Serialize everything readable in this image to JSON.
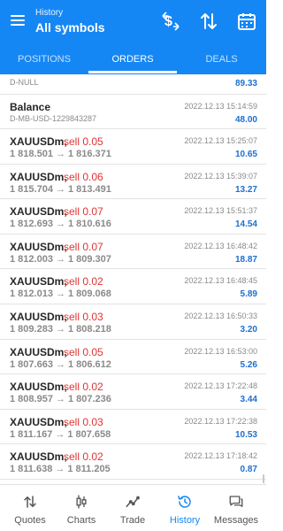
{
  "header": {
    "subtitle": "History",
    "title": "All symbols"
  },
  "tabs": [
    {
      "label": "POSITIONS"
    },
    {
      "label": "ORDERS",
      "active": true
    },
    {
      "label": "DEALS"
    }
  ],
  "top_partial": {
    "id": "D-NULL",
    "value": "89.33"
  },
  "balance": {
    "label": "Balance",
    "time": "2022.12.13 15:14:59",
    "id": "D-MB-USD-1229843287",
    "amount": "48.00"
  },
  "deals": [
    {
      "symbol": "XAUUSDm,",
      "side": "sell 0.05",
      "time": "2022.12.13 15:25:07",
      "open": "1 818.501",
      "close": "1 816.371",
      "profit": "10.65"
    },
    {
      "symbol": "XAUUSDm,",
      "side": "sell 0.06",
      "time": "2022.12.13 15:39:07",
      "open": "1 815.704",
      "close": "1 813.491",
      "profit": "13.27"
    },
    {
      "symbol": "XAUUSDm,",
      "side": "sell 0.07",
      "time": "2022.12.13 15:51:37",
      "open": "1 812.693",
      "close": "1 810.616",
      "profit": "14.54"
    },
    {
      "symbol": "XAUUSDm,",
      "side": "sell 0.07",
      "time": "2022.12.13 16:48:42",
      "open": "1 812.003",
      "close": "1 809.307",
      "profit": "18.87"
    },
    {
      "symbol": "XAUUSDm,",
      "side": "sell 0.02",
      "time": "2022.12.13 16:48:45",
      "open": "1 812.013",
      "close": "1 809.068",
      "profit": "5.89"
    },
    {
      "symbol": "XAUUSDm,",
      "side": "sell 0.03",
      "time": "2022.12.13 16:50:33",
      "open": "1 809.283",
      "close": "1 808.218",
      "profit": "3.20"
    },
    {
      "symbol": "XAUUSDm,",
      "side": "sell 0.05",
      "time": "2022.12.13 16:53:00",
      "open": "1 807.663",
      "close": "1 806.612",
      "profit": "5.26"
    },
    {
      "symbol": "XAUUSDm,",
      "side": "sell 0.02",
      "time": "2022.12.13 17:22:48",
      "open": "1 808.957",
      "close": "1 807.236",
      "profit": "3.44"
    },
    {
      "symbol": "XAUUSDm,",
      "side": "sell 0.03",
      "time": "2022.12.13 17:22:38",
      "open": "1 811.167",
      "close": "1 807.658",
      "profit": "10.53"
    },
    {
      "symbol": "XAUUSDm,",
      "side": "sell 0.02",
      "time": "2022.12.13 17:18:42",
      "open": "1 811.638",
      "close": "1 811.205",
      "profit": "0.87"
    }
  ],
  "arrow": "→",
  "nav": [
    {
      "label": "Quotes",
      "icon": "quotes-arrows-icon"
    },
    {
      "label": "Charts",
      "icon": "candlestick-icon"
    },
    {
      "label": "Trade",
      "icon": "trade-line-icon"
    },
    {
      "label": "History",
      "icon": "history-clock-icon",
      "active": true
    },
    {
      "label": "Messages",
      "icon": "messages-icon"
    }
  ],
  "colors": {
    "accent": "#1587f5",
    "sell": "#e03333",
    "profit": "#1d6fd1",
    "muted": "#8a8a8a"
  }
}
